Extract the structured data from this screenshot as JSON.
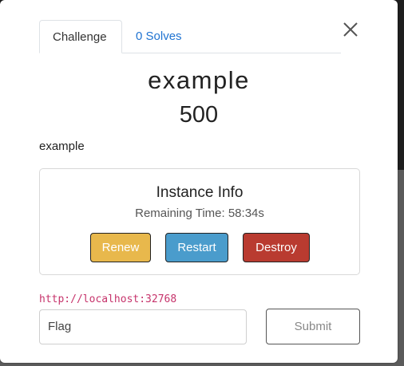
{
  "tabs": {
    "challenge": "Challenge",
    "solves": "0 Solves"
  },
  "challenge": {
    "name": "example",
    "value": "500",
    "description": "example"
  },
  "instance": {
    "title": "Instance Info",
    "remaining": "Remaining Time: 58:34s",
    "buttons": {
      "renew": "Renew",
      "restart": "Restart",
      "destroy": "Destroy"
    }
  },
  "connection": {
    "url": "http://localhost:32768"
  },
  "flag": {
    "placeholder": "Flag",
    "submit": "Submit"
  },
  "icons": {
    "close": "close-icon"
  },
  "colors": {
    "renew": "#e8b84c",
    "restart": "#4a9ccc",
    "destroy": "#b93b30",
    "link": "#c6336b",
    "tab_link": "#1f73d1"
  }
}
